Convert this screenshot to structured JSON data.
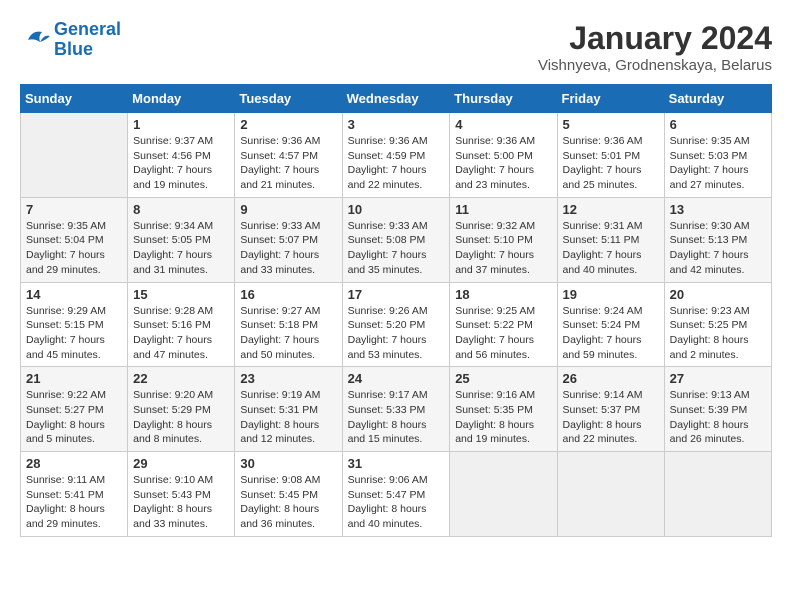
{
  "logo": {
    "line1": "General",
    "line2": "Blue"
  },
  "title": "January 2024",
  "subtitle": "Vishnyeva, Grodnenskaya, Belarus",
  "days_of_week": [
    "Sunday",
    "Monday",
    "Tuesday",
    "Wednesday",
    "Thursday",
    "Friday",
    "Saturday"
  ],
  "weeks": [
    [
      {
        "day": "",
        "info": ""
      },
      {
        "day": "1",
        "info": "Sunrise: 9:37 AM\nSunset: 4:56 PM\nDaylight: 7 hours\nand 19 minutes."
      },
      {
        "day": "2",
        "info": "Sunrise: 9:36 AM\nSunset: 4:57 PM\nDaylight: 7 hours\nand 21 minutes."
      },
      {
        "day": "3",
        "info": "Sunrise: 9:36 AM\nSunset: 4:59 PM\nDaylight: 7 hours\nand 22 minutes."
      },
      {
        "day": "4",
        "info": "Sunrise: 9:36 AM\nSunset: 5:00 PM\nDaylight: 7 hours\nand 23 minutes."
      },
      {
        "day": "5",
        "info": "Sunrise: 9:36 AM\nSunset: 5:01 PM\nDaylight: 7 hours\nand 25 minutes."
      },
      {
        "day": "6",
        "info": "Sunrise: 9:35 AM\nSunset: 5:03 PM\nDaylight: 7 hours\nand 27 minutes."
      }
    ],
    [
      {
        "day": "7",
        "info": "Sunrise: 9:35 AM\nSunset: 5:04 PM\nDaylight: 7 hours\nand 29 minutes."
      },
      {
        "day": "8",
        "info": "Sunrise: 9:34 AM\nSunset: 5:05 PM\nDaylight: 7 hours\nand 31 minutes."
      },
      {
        "day": "9",
        "info": "Sunrise: 9:33 AM\nSunset: 5:07 PM\nDaylight: 7 hours\nand 33 minutes."
      },
      {
        "day": "10",
        "info": "Sunrise: 9:33 AM\nSunset: 5:08 PM\nDaylight: 7 hours\nand 35 minutes."
      },
      {
        "day": "11",
        "info": "Sunrise: 9:32 AM\nSunset: 5:10 PM\nDaylight: 7 hours\nand 37 minutes."
      },
      {
        "day": "12",
        "info": "Sunrise: 9:31 AM\nSunset: 5:11 PM\nDaylight: 7 hours\nand 40 minutes."
      },
      {
        "day": "13",
        "info": "Sunrise: 9:30 AM\nSunset: 5:13 PM\nDaylight: 7 hours\nand 42 minutes."
      }
    ],
    [
      {
        "day": "14",
        "info": "Sunrise: 9:29 AM\nSunset: 5:15 PM\nDaylight: 7 hours\nand 45 minutes."
      },
      {
        "day": "15",
        "info": "Sunrise: 9:28 AM\nSunset: 5:16 PM\nDaylight: 7 hours\nand 47 minutes."
      },
      {
        "day": "16",
        "info": "Sunrise: 9:27 AM\nSunset: 5:18 PM\nDaylight: 7 hours\nand 50 minutes."
      },
      {
        "day": "17",
        "info": "Sunrise: 9:26 AM\nSunset: 5:20 PM\nDaylight: 7 hours\nand 53 minutes."
      },
      {
        "day": "18",
        "info": "Sunrise: 9:25 AM\nSunset: 5:22 PM\nDaylight: 7 hours\nand 56 minutes."
      },
      {
        "day": "19",
        "info": "Sunrise: 9:24 AM\nSunset: 5:24 PM\nDaylight: 7 hours\nand 59 minutes."
      },
      {
        "day": "20",
        "info": "Sunrise: 9:23 AM\nSunset: 5:25 PM\nDaylight: 8 hours\nand 2 minutes."
      }
    ],
    [
      {
        "day": "21",
        "info": "Sunrise: 9:22 AM\nSunset: 5:27 PM\nDaylight: 8 hours\nand 5 minutes."
      },
      {
        "day": "22",
        "info": "Sunrise: 9:20 AM\nSunset: 5:29 PM\nDaylight: 8 hours\nand 8 minutes."
      },
      {
        "day": "23",
        "info": "Sunrise: 9:19 AM\nSunset: 5:31 PM\nDaylight: 8 hours\nand 12 minutes."
      },
      {
        "day": "24",
        "info": "Sunrise: 9:17 AM\nSunset: 5:33 PM\nDaylight: 8 hours\nand 15 minutes."
      },
      {
        "day": "25",
        "info": "Sunrise: 9:16 AM\nSunset: 5:35 PM\nDaylight: 8 hours\nand 19 minutes."
      },
      {
        "day": "26",
        "info": "Sunrise: 9:14 AM\nSunset: 5:37 PM\nDaylight: 8 hours\nand 22 minutes."
      },
      {
        "day": "27",
        "info": "Sunrise: 9:13 AM\nSunset: 5:39 PM\nDaylight: 8 hours\nand 26 minutes."
      }
    ],
    [
      {
        "day": "28",
        "info": "Sunrise: 9:11 AM\nSunset: 5:41 PM\nDaylight: 8 hours\nand 29 minutes."
      },
      {
        "day": "29",
        "info": "Sunrise: 9:10 AM\nSunset: 5:43 PM\nDaylight: 8 hours\nand 33 minutes."
      },
      {
        "day": "30",
        "info": "Sunrise: 9:08 AM\nSunset: 5:45 PM\nDaylight: 8 hours\nand 36 minutes."
      },
      {
        "day": "31",
        "info": "Sunrise: 9:06 AM\nSunset: 5:47 PM\nDaylight: 8 hours\nand 40 minutes."
      },
      {
        "day": "",
        "info": ""
      },
      {
        "day": "",
        "info": ""
      },
      {
        "day": "",
        "info": ""
      }
    ]
  ]
}
